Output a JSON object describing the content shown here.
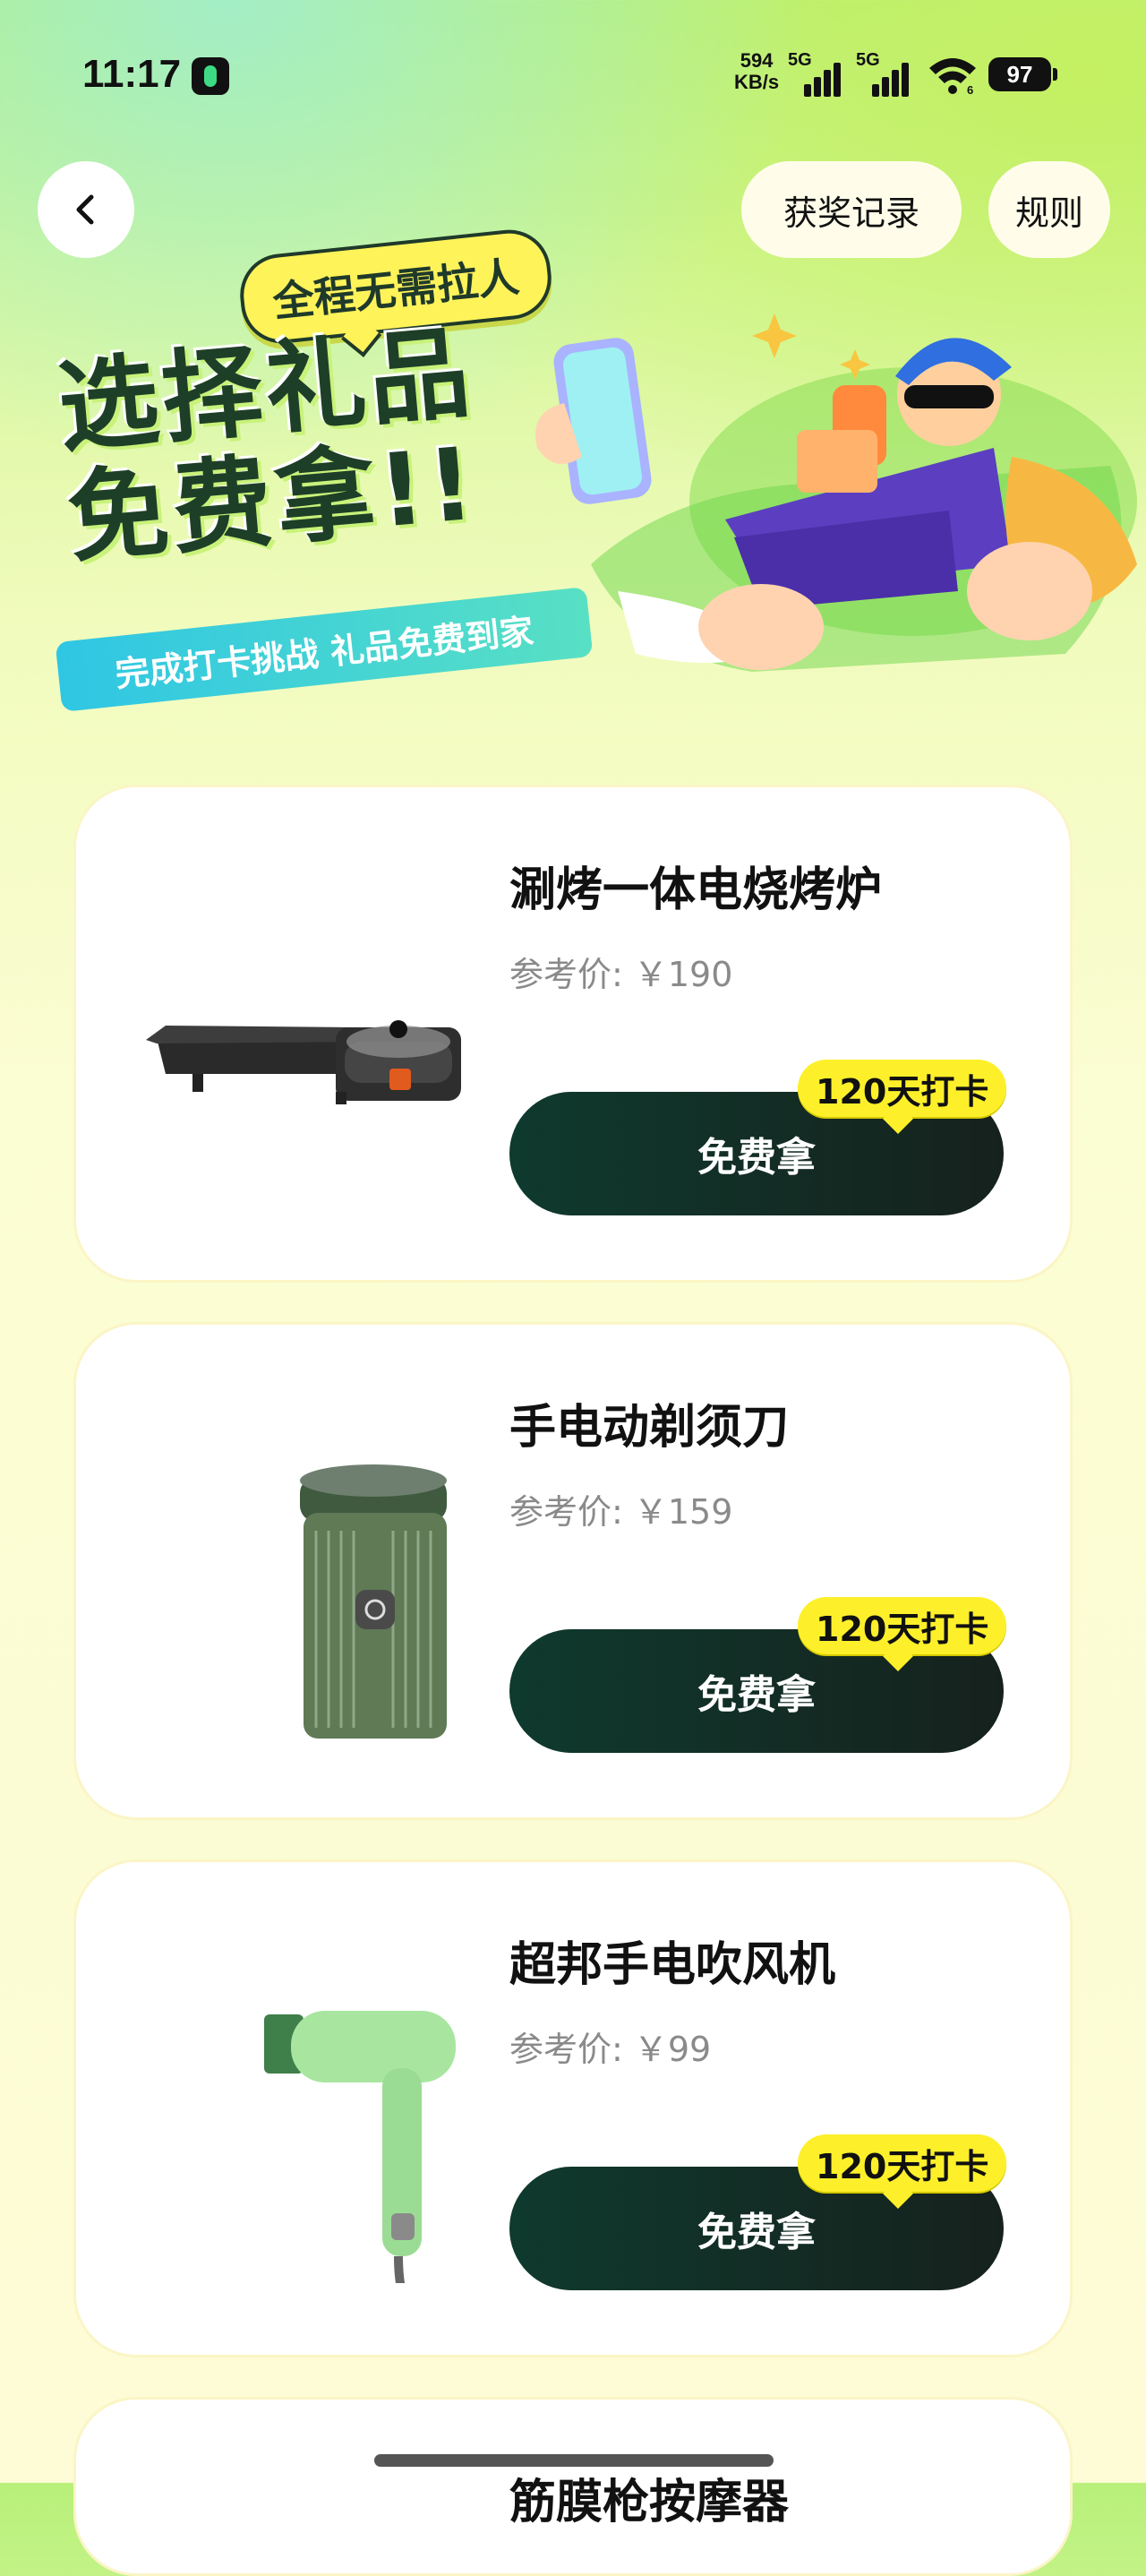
{
  "status_bar": {
    "time": "11:17",
    "net_speed_value": "594",
    "net_speed_unit": "KB/s",
    "signal_1_label": "5G",
    "signal_2_label": "5G",
    "wifi_level": "6",
    "battery": "97"
  },
  "header": {
    "records_label": "获奖记录",
    "rules_label": "规则"
  },
  "hero": {
    "tag": "全程无需拉人",
    "title_line1": "选择礼品",
    "title_line2": "免费拿!!",
    "subtitle": "完成打卡挑战 礼品免费到家"
  },
  "products": [
    {
      "name": "涮烤一体电烧烤炉",
      "price": "参考价: ￥190",
      "button": "免费拿",
      "badge": "120天打卡"
    },
    {
      "name": "手电动剃须刀",
      "price": "参考价: ￥159",
      "button": "免费拿",
      "badge": "120天打卡"
    },
    {
      "name": "超邦手电吹风机",
      "price": "参考价: ￥99",
      "button": "免费拿",
      "badge": "120天打卡"
    }
  ],
  "partial_product": {
    "name": "筋膜枪按摩器"
  },
  "colors": {
    "button_dark": "#0f3a2e",
    "badge_yellow": "#fdf02a",
    "hero_title": "#1e3f27",
    "subtitle_bar": "#2fc6e4"
  }
}
